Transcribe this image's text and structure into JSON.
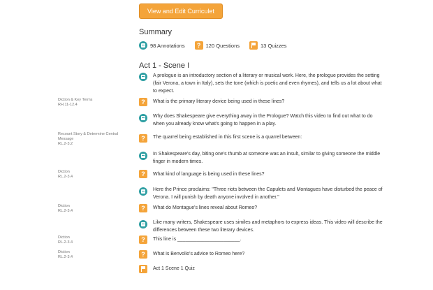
{
  "button": {
    "label": "View and Edit Curriculet"
  },
  "summary": {
    "title": "Summary",
    "stats": [
      {
        "icon": "annotation-icon",
        "label": "98 Annotations"
      },
      {
        "icon": "question-icon",
        "label": "120 Questions"
      },
      {
        "icon": "quiz-icon",
        "label": "13 Quizzes"
      }
    ]
  },
  "section_title": "Act 1 - Scene I",
  "items": [
    {
      "type": "annotation",
      "standard": "",
      "code": "",
      "text": "A prologue is an introductory section of a literary or musical work. Here, the prologue provides the setting (fair Verona, a town in Italy), sets the tone (which is poetic and even rhymes), and tells us a lot about what to expect."
    },
    {
      "type": "question",
      "standard": "Diction & Key Terms",
      "code": "RH.11-12.4",
      "text": "What is the primary literary device being used in these lines?"
    },
    {
      "type": "annotation",
      "standard": "",
      "code": "",
      "text": "Why does Shakespeare give everything away in the Prologue? Watch this video to find out what to do when you already know what's going to happen in a play."
    },
    {
      "type": "question",
      "standard": "Recount Story & Determine Central Message",
      "code": "RL.2-3.2",
      "text": "The quarrel being established in this first scene is a quarrel between:"
    },
    {
      "type": "annotation",
      "standard": "",
      "code": "",
      "text": "In Shakespeare's day, biting one's thumb at someone was an insult, similar to giving someone the middle finger in modern times."
    },
    {
      "type": "question",
      "standard": "Diction",
      "code": "RL.2-3.4",
      "text": "What kind of language is being used in these lines?"
    },
    {
      "type": "annotation",
      "standard": "",
      "code": "",
      "text": "Here the Prince proclaims: \"Three riots between the Capulets and Montagues have disturbed the peace of Verona. I will punish by death anyone involved in another.\""
    },
    {
      "type": "question",
      "standard": "Diction",
      "code": "RL.2-3.4",
      "text": "What do Montague's lines reveal about Romeo?"
    },
    {
      "type": "annotation",
      "standard": "",
      "code": "",
      "text": " Like many writers, Shakespeare uses similes and metaphors to express ideas. This video will describe the differences between these two literary devices."
    },
    {
      "type": "question",
      "standard": "Diction",
      "code": "RL.2-3.4",
      "text": "This line is  _______________________."
    },
    {
      "type": "question",
      "standard": "Diction",
      "code": "RL.2-3.4",
      "text": "What is Benvolio's advice to Romeo here?"
    },
    {
      "type": "quiz",
      "standard": "",
      "code": "",
      "text": "Act 1 Scene 1 Quiz"
    }
  ]
}
